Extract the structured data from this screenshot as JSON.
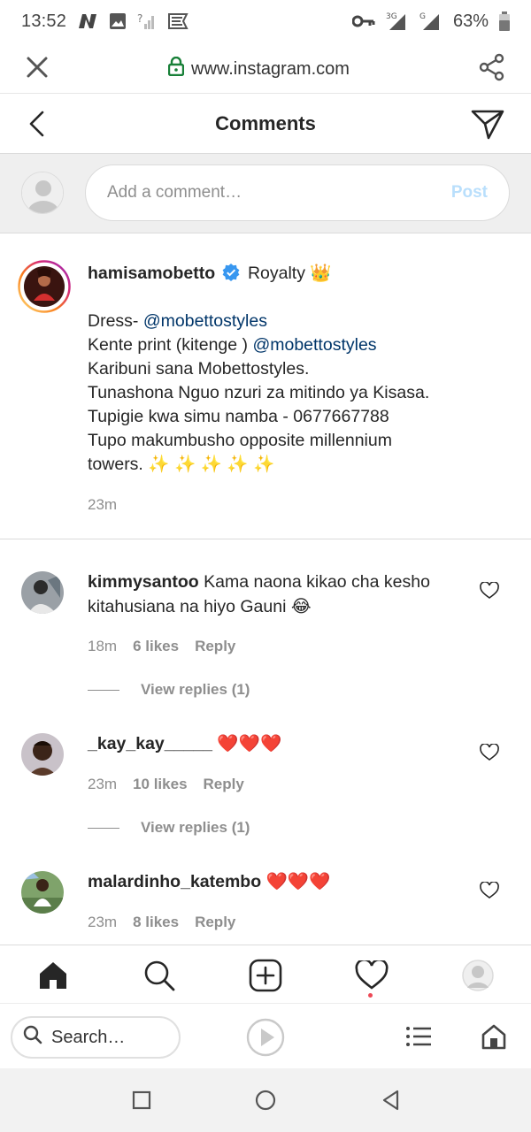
{
  "status_bar": {
    "time": "13:52",
    "battery": "63%",
    "network_a": "3G",
    "network_b": "G",
    "icons": [
      "notification-n-icon",
      "image-icon",
      "signal-question-icon",
      "flag-icon",
      "key-icon",
      "signal-3g-icon",
      "signal-g-icon",
      "battery-icon"
    ]
  },
  "browser": {
    "url": "www.instagram.com",
    "icons": [
      "close-icon",
      "lock-icon",
      "share-icon"
    ]
  },
  "header": {
    "title": "Comments",
    "icons": [
      "back-chevron-icon",
      "direct-send-icon"
    ]
  },
  "add_comment": {
    "placeholder": "Add a comment…",
    "post_label": "Post"
  },
  "caption": {
    "username": "hamisamobetto",
    "after_badge": "Royalty",
    "crown": "👑",
    "lines": [
      {
        "pre": "Dress- ",
        "mention": "@mobettostyles"
      },
      {
        "pre": "Kente print (kitenge ) ",
        "mention": "@mobettostyles"
      },
      {
        "pre": "Karibuni sana Mobettostyles.",
        "mention": ""
      },
      {
        "pre": "Tunashona Nguo nzuri za mitindo ya Kisasa.",
        "mention": ""
      },
      {
        "pre": "Tupigie kwa simu namba - 0677667788",
        "mention": ""
      },
      {
        "pre": "Tupo makumbusho opposite millennium",
        "mention": ""
      },
      {
        "pre": "towers. ✨ ✨ ✨ ✨ ✨",
        "mention": ""
      }
    ],
    "time": "23m"
  },
  "comments": [
    {
      "username": "kimmysantoo",
      "text": " Kama naona kikao cha kesho",
      "text2": "kitahusiana na hiyo Gauni 😂",
      "time": "18m",
      "likes": "6 likes",
      "reply": "Reply",
      "view_replies": "View replies (1)"
    },
    {
      "username": "_kay_kay_____",
      "text": " ❤️❤️❤️",
      "time": "23m",
      "likes": "10 likes",
      "reply": "Reply",
      "view_replies": "View replies (1)"
    },
    {
      "username": "malardinho_katembo",
      "text": " ❤️❤️❤️",
      "time": "23m",
      "likes": "8 likes",
      "reply": "Reply"
    }
  ],
  "ig_nav": {
    "items": [
      "home-icon",
      "search-icon",
      "new-post-icon",
      "activity-heart-icon",
      "profile-avatar-icon"
    ]
  },
  "browser_toolbar": {
    "search_placeholder": "Search…",
    "icons": [
      "search-icon",
      "play-icon",
      "tabs-list-icon",
      "home-icon"
    ]
  },
  "android_nav": {
    "icons": [
      "recents-square-icon",
      "home-circle-icon",
      "back-triangle-icon"
    ]
  },
  "colors": {
    "mention": "#003569",
    "post_disabled": "#b9dffc",
    "meta_gray": "#8e8e8e",
    "heart_red": "#ed4956",
    "verified_blue": "#3897f0"
  }
}
